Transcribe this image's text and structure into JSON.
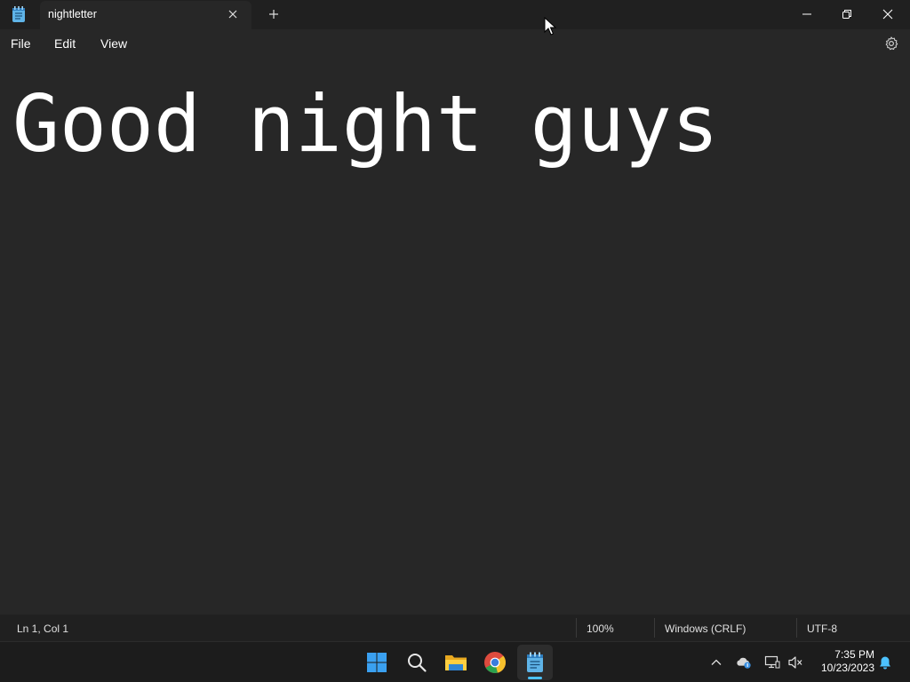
{
  "window": {
    "tab_title": "nightletter"
  },
  "menu": {
    "items": [
      {
        "label": "File"
      },
      {
        "label": "Edit"
      },
      {
        "label": "View"
      }
    ]
  },
  "editor": {
    "content": "Good night guys"
  },
  "status": {
    "position": "Ln 1, Col 1",
    "zoom": "100%",
    "line_ending": "Windows (CRLF)",
    "encoding": "UTF-8"
  },
  "taskbar": {
    "pinned": [
      {
        "name": "start-button"
      },
      {
        "name": "search-button"
      },
      {
        "name": "file-explorer"
      },
      {
        "name": "chrome"
      },
      {
        "name": "notepad"
      }
    ],
    "clock_time": "7:35 PM",
    "clock_date": "10/23/2023"
  },
  "colors": {
    "background": "#272727",
    "titlebar": "#202020",
    "taskbar": "#1c1c1c",
    "accent": "#4cc2ff",
    "text": "#ffffff"
  },
  "icons": [
    "notepad-icon",
    "close-icon",
    "plus-icon",
    "minimize-icon",
    "restore-icon",
    "gear-icon",
    "windows-logo-icon",
    "search-icon",
    "folder-icon",
    "chrome-icon",
    "chevron-up-icon",
    "onedrive-icon",
    "network-icon",
    "speaker-muted-icon",
    "bell-icon"
  ]
}
